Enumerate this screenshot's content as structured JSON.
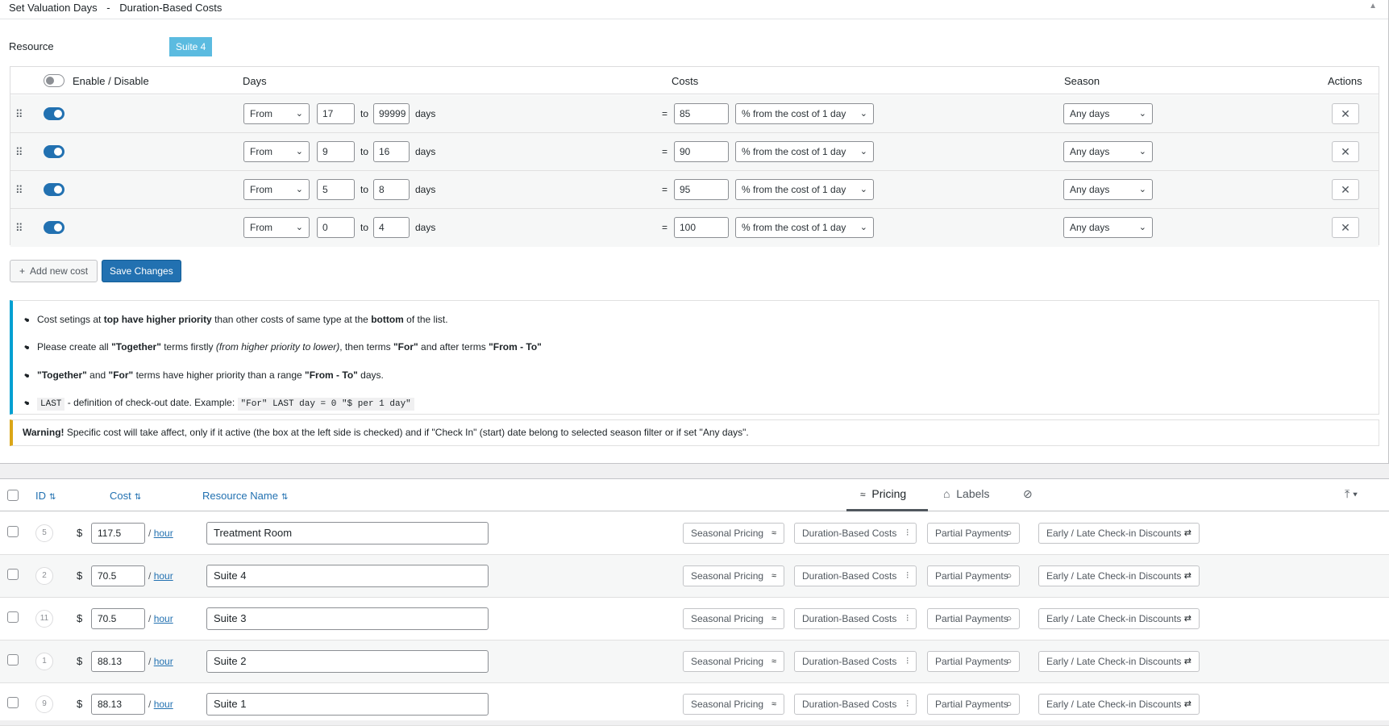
{
  "header": {
    "title": "Set Valuation Days",
    "separator": "-",
    "subtitle": "Duration-Based Costs"
  },
  "resource": {
    "label": "Resource",
    "badge": "Suite 4"
  },
  "cost_table": {
    "columns": {
      "enable": "Enable / Disable",
      "days": "Days",
      "costs": "Costs",
      "season": "Season",
      "actions": "Actions"
    },
    "to_label": "to",
    "days_label": "days",
    "equals": "=",
    "rows": [
      {
        "enabled": true,
        "mode": "From",
        "from": "17",
        "to": "99999",
        "cost": "85",
        "cost_type": "% from the cost of 1 day",
        "season": "Any days"
      },
      {
        "enabled": true,
        "mode": "From",
        "from": "9",
        "to": "16",
        "cost": "90",
        "cost_type": "% from the cost of 1 day",
        "season": "Any days"
      },
      {
        "enabled": true,
        "mode": "From",
        "from": "5",
        "to": "8",
        "cost": "95",
        "cost_type": "% from the cost of 1 day",
        "season": "Any days"
      },
      {
        "enabled": true,
        "mode": "From",
        "from": "0",
        "to": "4",
        "cost": "100",
        "cost_type": "% from the cost of 1 day",
        "season": "Any days"
      }
    ]
  },
  "buttons": {
    "add_new_cost": "Add new cost",
    "save_changes": "Save Changes"
  },
  "notice": {
    "line1": {
      "a": "Cost setings at ",
      "b": "top have higher priority",
      "c": " than other costs of same type at the ",
      "d": "bottom",
      "e": " of the list."
    },
    "line2": {
      "a": "Please create all ",
      "b": "\"Together\"",
      "c": " terms firstly ",
      "d": "(from higher priority to lower)",
      "e": ", then terms ",
      "f": "\"For\"",
      "g": " and after terms ",
      "h": "\"From - To\""
    },
    "line3": {
      "a": "\"Together\"",
      "b": " and ",
      "c": "\"For\"",
      "d": " terms have higher priority than a range ",
      "e": "\"From - To\"",
      "f": " days."
    },
    "line4": {
      "code1": "LAST",
      "a": " - definition of check-out date. Example: ",
      "code2": "\"For\" LAST day = 0 \"$ per 1 day\""
    }
  },
  "warning": {
    "bold": "Warning!",
    "text": " Specific cost will take affect, only if it active (the box at the left side is checked) and if \"Check In\" (start) date belong to selected season filter or if set \"Any days\"."
  },
  "list": {
    "columns": {
      "id": "ID",
      "cost": "Cost",
      "name": "Resource Name"
    },
    "tabs": {
      "pricing": "Pricing",
      "labels": "Labels"
    },
    "currency": "$",
    "per_slash": "/",
    "per_unit": "hour",
    "pills": {
      "seasonal": "Seasonal Pricing",
      "duration": "Duration-Based Costs",
      "partial": "Partial Payments",
      "early_late": "Early / Late Check-in Discounts"
    },
    "rows": [
      {
        "id": "5",
        "cost": "117.5",
        "name": "Treatment Room"
      },
      {
        "id": "2",
        "cost": "70.5",
        "name": "Suite 4"
      },
      {
        "id": "11",
        "cost": "70.5",
        "name": "Suite 3"
      },
      {
        "id": "1",
        "cost": "88.13",
        "name": "Suite 2"
      },
      {
        "id": "9",
        "cost": "88.13",
        "name": "Suite 1"
      }
    ]
  }
}
